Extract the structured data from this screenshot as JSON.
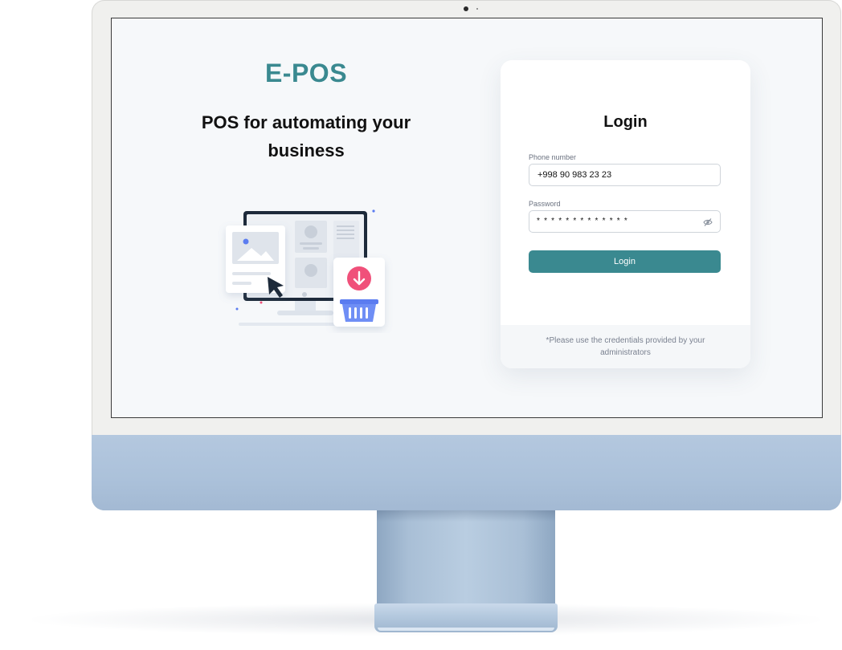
{
  "app": {
    "brand": "E-POS",
    "tagline": "POS for automating your business"
  },
  "login": {
    "title": "Login",
    "phone": {
      "label": "Phone number",
      "value": "+998 90 983 23 23"
    },
    "password": {
      "label": "Password",
      "masked_value": "* * * * * * * * * * * * *",
      "toggle_icon": "eye-off-icon"
    },
    "submit_label": "Login",
    "footer_note": "*Please use the credentials provided by your administrators"
  },
  "colors": {
    "accent": "#3a8990",
    "download_badge": "#f0507a",
    "basket": "#5b7cf0"
  }
}
